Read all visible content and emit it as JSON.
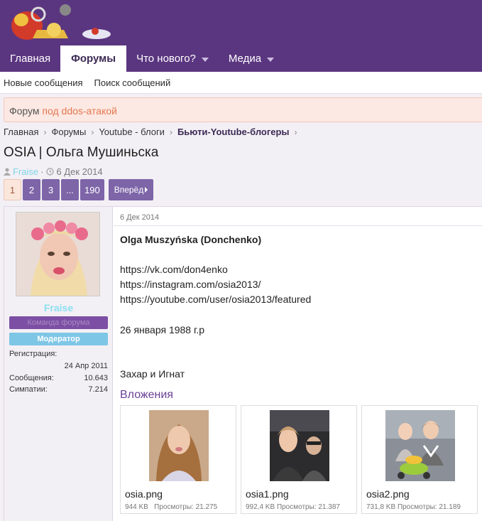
{
  "colors": {
    "header": "#5b3680",
    "accent": "#6a3f96",
    "username": "#8be0f0",
    "notice_bg": "#fde9e3",
    "notice_highlight": "#e3774f"
  },
  "nav": {
    "tabs": [
      {
        "label": "Главная",
        "active": false,
        "dropdown": false
      },
      {
        "label": "Форумы",
        "active": true,
        "dropdown": false
      },
      {
        "label": "Что нового?",
        "active": false,
        "dropdown": true
      },
      {
        "label": "Медиа",
        "active": false,
        "dropdown": true
      }
    ]
  },
  "subnav": {
    "items": [
      "Новые сообщения",
      "Поиск сообщений"
    ]
  },
  "notice": {
    "prefix": "Форум",
    "highlight": "под ddos-атакой"
  },
  "breadcrumbs": [
    "Главная",
    "Форумы",
    "Youtube - блоги",
    "Бьюти-Youtube-блогеры"
  ],
  "thread": {
    "title": "OSIA | Ольга Мушиньска",
    "author": "Fraise",
    "date": "6 Дек 2014"
  },
  "pagination": {
    "pages": [
      "1",
      "2",
      "3",
      "...",
      "190"
    ],
    "current": "1",
    "next_label": "Вперёд"
  },
  "user": {
    "name": "Fraise",
    "team_badge": "Команда форума",
    "role_badge": "Модератор",
    "reg_label": "Регистрация:",
    "reg_value": "24 Апр 2011",
    "messages_label": "Сообщения:",
    "messages_value": "10.643",
    "likes_label": "Симпатии:",
    "likes_value": "7.214"
  },
  "post": {
    "date": "6 Дек 2014",
    "heading": "Olga Muszyńska (Donchenko)",
    "links": [
      "https://vk.com/don4enko",
      "https://instagram.com/osia2013/",
      "https://youtube.com/user/osia2013/featured"
    ],
    "birthday": "26 января 1988 г.р",
    "children": "Захар и Игнат",
    "attachments_title": "Вложения",
    "attachments": [
      {
        "name": "osia.png",
        "size": "944 KB",
        "views_label": "Просмотры:",
        "views": "21.275"
      },
      {
        "name": "osia1.png",
        "size": "992,4 KB",
        "views_label": "Просмотры:",
        "views": "21.387"
      },
      {
        "name": "osia2.png",
        "size": "731,8 KB",
        "views_label": "Просмотры:",
        "views": "21.189"
      }
    ]
  }
}
